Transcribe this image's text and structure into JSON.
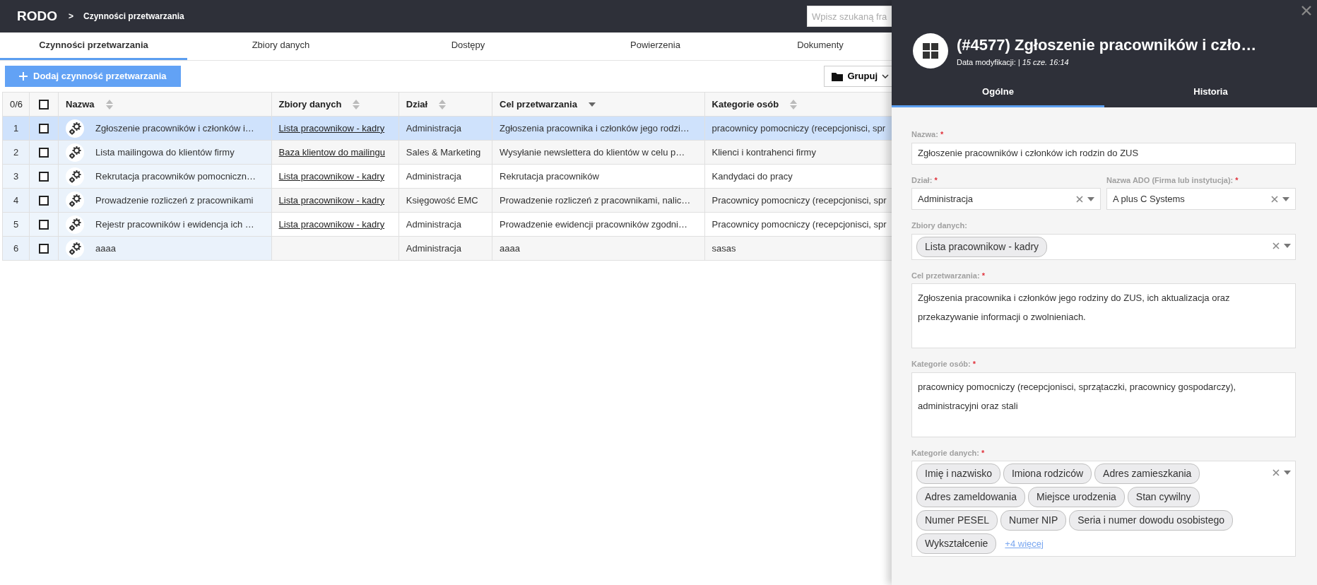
{
  "app": {
    "title": "RODO",
    "separator": ">",
    "breadcrumb": "Czynności przetwarzania",
    "search": {
      "placeholder": "Wpisz szukaną fra"
    }
  },
  "tabs": [
    {
      "label": "Czynności przetwarzania",
      "selected": true
    },
    {
      "label": "Zbiory danych",
      "selected": false
    },
    {
      "label": "Dostępy",
      "selected": false
    },
    {
      "label": "Powierzenia",
      "selected": false
    },
    {
      "label": "Dokumenty",
      "selected": false
    }
  ],
  "toolbar": {
    "add_button": "Dodaj czynność przetwarzania",
    "group_button": "Grupuj"
  },
  "table": {
    "count": "0/6",
    "select_all_checked": false,
    "columns": [
      {
        "label": "Nazwa",
        "sorted": false
      },
      {
        "label": "Zbiory danych",
        "sorted": false
      },
      {
        "label": "Dział",
        "sorted": false
      },
      {
        "label": "Cel przetwarzania",
        "sorted": true
      },
      {
        "label": "Kategorie osób",
        "sorted": false
      }
    ],
    "rows": [
      {
        "number": "1",
        "checked": false,
        "selected": true,
        "name": "Zgłoszenie pracowników i członków i…",
        "data_set": "Lista pracownikow - kadry",
        "department": "Administracja",
        "purpose": "Zgłoszenia pracownika i członków jego rodzi…",
        "categories": "pracownicy pomocniczy (recepcjonisci, spr"
      },
      {
        "number": "2",
        "checked": false,
        "selected": false,
        "name": "Lista mailingowa do klientów firmy",
        "data_set": "Baza klientow do mailingu",
        "department": "Sales & Marketing",
        "purpose": "Wysyłanie newslettera do klientów w celu p…",
        "categories": "Klienci i kontrahenci firmy"
      },
      {
        "number": "3",
        "checked": false,
        "selected": false,
        "name": "Rekrutacja pracowników pomocniczn…",
        "data_set": "Lista pracownikow - kadry",
        "department": "Administracja",
        "purpose": "Rekrutacja pracowników",
        "categories": "Kandydaci do pracy"
      },
      {
        "number": "4",
        "checked": false,
        "selected": false,
        "name": "Prowadzenie rozliczeń z pracownikami",
        "data_set": "Lista pracownikow - kadry",
        "department": "Księgowość EMC",
        "purpose": "Prowadzenie rozliczeń z pracownikami, nalic…",
        "categories": "Pracownicy pomocniczy (recepcjonisci, spr"
      },
      {
        "number": "5",
        "checked": false,
        "selected": false,
        "name": "Rejestr pracowników i ewidencja ich …",
        "data_set": "Lista pracownikow - kadry",
        "department": "Administracja",
        "purpose": "Prowadzenie ewidencji pracowników zgodni…",
        "categories": "Pracownicy pomocniczy (recepcjonisci, spr"
      },
      {
        "number": "6",
        "checked": false,
        "selected": false,
        "name": "aaaa",
        "department": "Administracja",
        "purpose": "aaaa",
        "categories": "sasas"
      }
    ]
  },
  "panel": {
    "title": "(#4577) Zgłoszenie pracowników i czło…",
    "modified_label": "Data modyfikacji:",
    "modified_value": "| 15 cze. 16:14",
    "tabs": [
      {
        "label": "Ogólne",
        "selected": true
      },
      {
        "label": "Historia",
        "selected": false
      }
    ],
    "fields": [
      {
        "kind": "text",
        "label": "Nazwa:",
        "required_mark": "*",
        "value": "Zgłoszenie pracowników i członków ich rodzin do ZUS"
      },
      {
        "kind": "pair",
        "items": [
          {
            "kind": "select",
            "label": "Dział:",
            "required_mark": "*",
            "value": "Administracja"
          },
          {
            "kind": "select",
            "label": "Nazwa ADO (Firma lub instytucja):",
            "required_mark": "*",
            "value": "A plus C Systems"
          }
        ]
      },
      {
        "kind": "tags",
        "label": "Zbiory danych:",
        "tags": [
          "Lista pracownikow - kadry"
        ]
      },
      {
        "kind": "textarea",
        "label": "Cel przetwarzania:",
        "required_mark": "*",
        "value": "Zgłoszenia pracownika i członków jego rodziny do ZUS, ich aktualizacja oraz przekazywanie informacji o zwolnieniach."
      },
      {
        "kind": "textarea",
        "label": "Kategorie osób:",
        "required_mark": "*",
        "value": "pracownicy pomocniczy (recepcjonisci, sprzątaczki, pracownicy gospodarczy), administracyjni oraz  stali"
      },
      {
        "kind": "tags",
        "label": "Kategorie danych:",
        "required_mark": "*",
        "tags": [
          "Imię i nazwisko",
          "Imiona rodziców",
          "Adres zamieszkania",
          "Adres zameldowania",
          "Miejsce urodzenia",
          "Stan cywilny",
          "Numer PESEL",
          "Numer NIP",
          "Seria i numer dowodu osobistego",
          "Wykształcenie"
        ],
        "more": "+4 więcej"
      }
    ]
  }
}
